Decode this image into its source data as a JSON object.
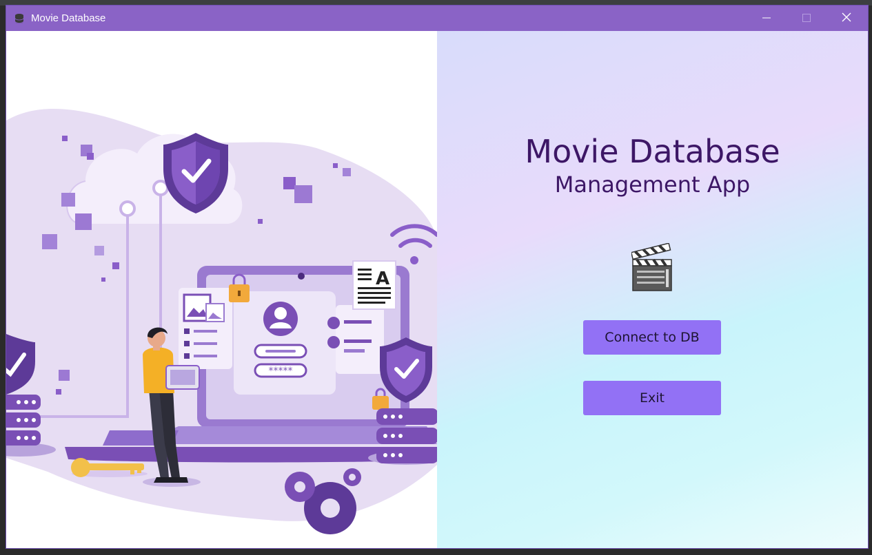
{
  "window": {
    "title": "Movie Database",
    "controls": {
      "minimize_icon": "minimize-icon",
      "maximize_icon": "maximize-icon",
      "close_icon": "close-icon"
    }
  },
  "main": {
    "heading": "Movie Database",
    "subheading": "Management App",
    "icon": "clapperboard-icon",
    "buttons": {
      "connect_label": "Connect to DB",
      "exit_label": "Exit"
    }
  },
  "illustration": {
    "keyboard_text": "*****"
  },
  "colors": {
    "titlebar": "#8a63c6",
    "button": "#9271f5",
    "heading": "#3d1766",
    "illustration_purple": "#7a4fb5"
  }
}
